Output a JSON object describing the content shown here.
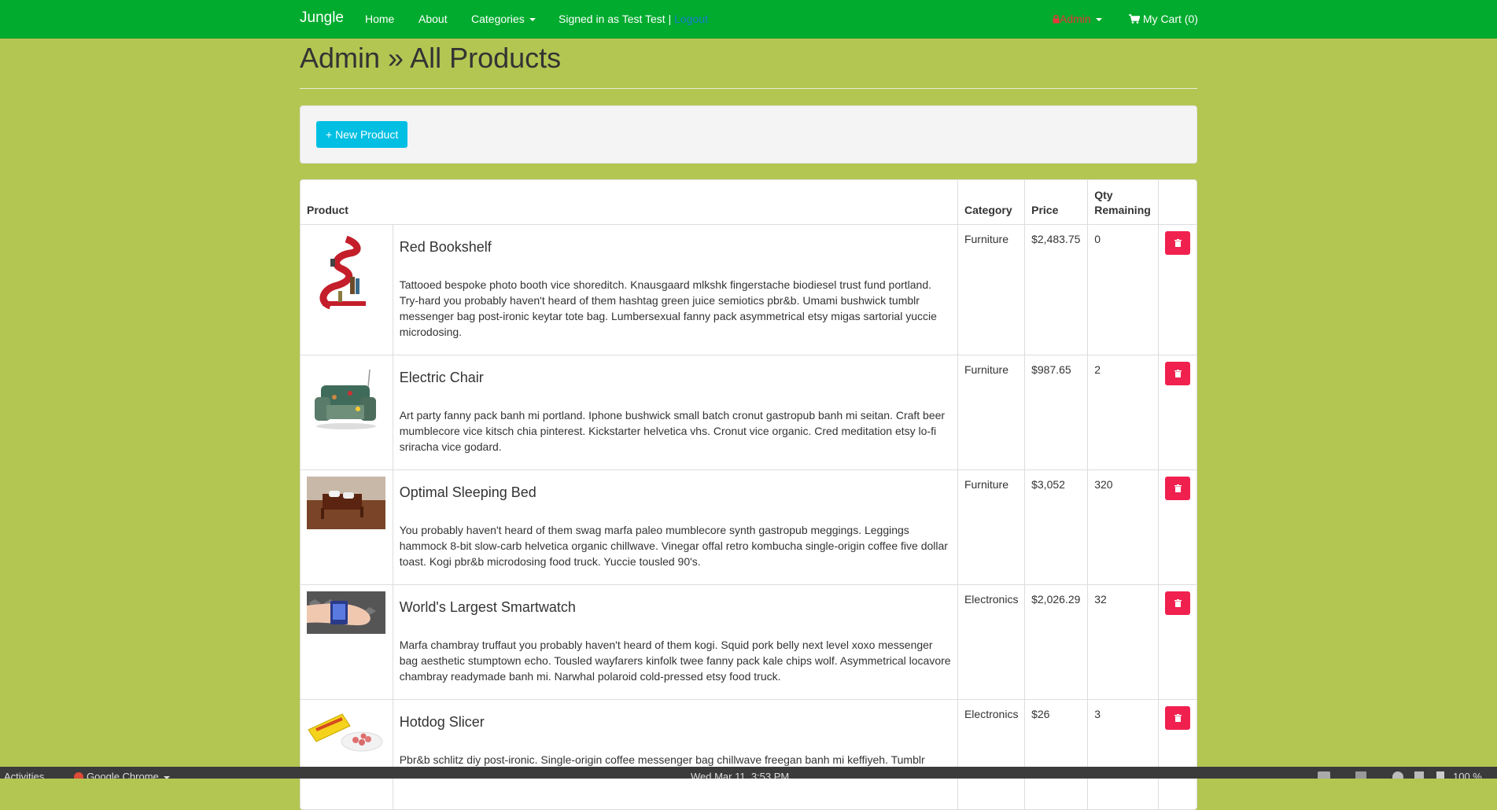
{
  "navbar": {
    "brand": "Jungle",
    "links": [
      "Home",
      "About"
    ],
    "categories_label": "Categories",
    "signed_in_text": "Signed in as Test Test |",
    "logout_label": "Logout",
    "admin_label": "Admin",
    "cart_label": "My Cart (0)"
  },
  "page": {
    "title": "Admin » All Products",
    "new_product_label": "+ New Product"
  },
  "table": {
    "headers": {
      "product": "Product",
      "category": "Category",
      "price": "Price",
      "qty": "Qty Remaining"
    },
    "rows": [
      {
        "name": "Red Bookshelf",
        "description": "Tattooed bespoke photo booth vice shoreditch. Knausgaard mlkshk fingerstache biodiesel trust fund portland. Try-hard you probably haven't heard of them hashtag green juice semiotics pbr&b. Umami bushwick tumblr messenger bag post-ironic keytar tote bag. Lumbersexual fanny pack asymmetrical etsy migas sartorial yuccie microdosing.",
        "category": "Furniture",
        "price": "$2,483.75",
        "qty": "0"
      },
      {
        "name": "Electric Chair",
        "description": "Art party fanny pack banh mi portland. Iphone bushwick small batch cronut gastropub banh mi seitan. Craft beer mumblecore vice kitsch chia pinterest. Kickstarter helvetica vhs. Cronut vice organic. Cred meditation etsy lo-fi sriracha vice godard.",
        "category": "Furniture",
        "price": "$987.65",
        "qty": "2"
      },
      {
        "name": "Optimal Sleeping Bed",
        "description": "You probably haven't heard of them swag marfa paleo mumblecore synth gastropub meggings. Leggings hammock 8-bit slow-carb helvetica organic chillwave. Vinegar offal retro kombucha single-origin coffee five dollar toast. Kogi pbr&b microdosing food truck. Yuccie tousled 90's.",
        "category": "Furniture",
        "price": "$3,052",
        "qty": "320"
      },
      {
        "name": "World's Largest Smartwatch",
        "description": "Marfa chambray truffaut you probably haven't heard of them kogi. Squid pork belly next level xoxo messenger bag aesthetic stumptown echo. Tousled wayfarers kinfolk twee fanny pack kale chips wolf. Asymmetrical locavore chambray readymade banh mi. Narwhal polaroid cold-pressed etsy food truck.",
        "category": "Electronics",
        "price": "$2,026.29",
        "qty": "32"
      },
      {
        "name": "Hotdog Slicer",
        "description": "Pbr&b schlitz diy post-ironic. Single-origin coffee messenger bag chillwave freegan banh mi keffiyeh. Tumblr",
        "category": "Electronics",
        "price": "$26",
        "qty": "3"
      }
    ]
  },
  "taskbar": {
    "activities": "Activities",
    "app": "Google Chrome",
    "clock": "Wed Mar 11,  3:53 PM",
    "battery": "100 %"
  },
  "colors": {
    "background": "#b3c652",
    "navbar": "#00ab2e",
    "new_button": "#00bfe3",
    "delete_button": "#f0214f"
  }
}
